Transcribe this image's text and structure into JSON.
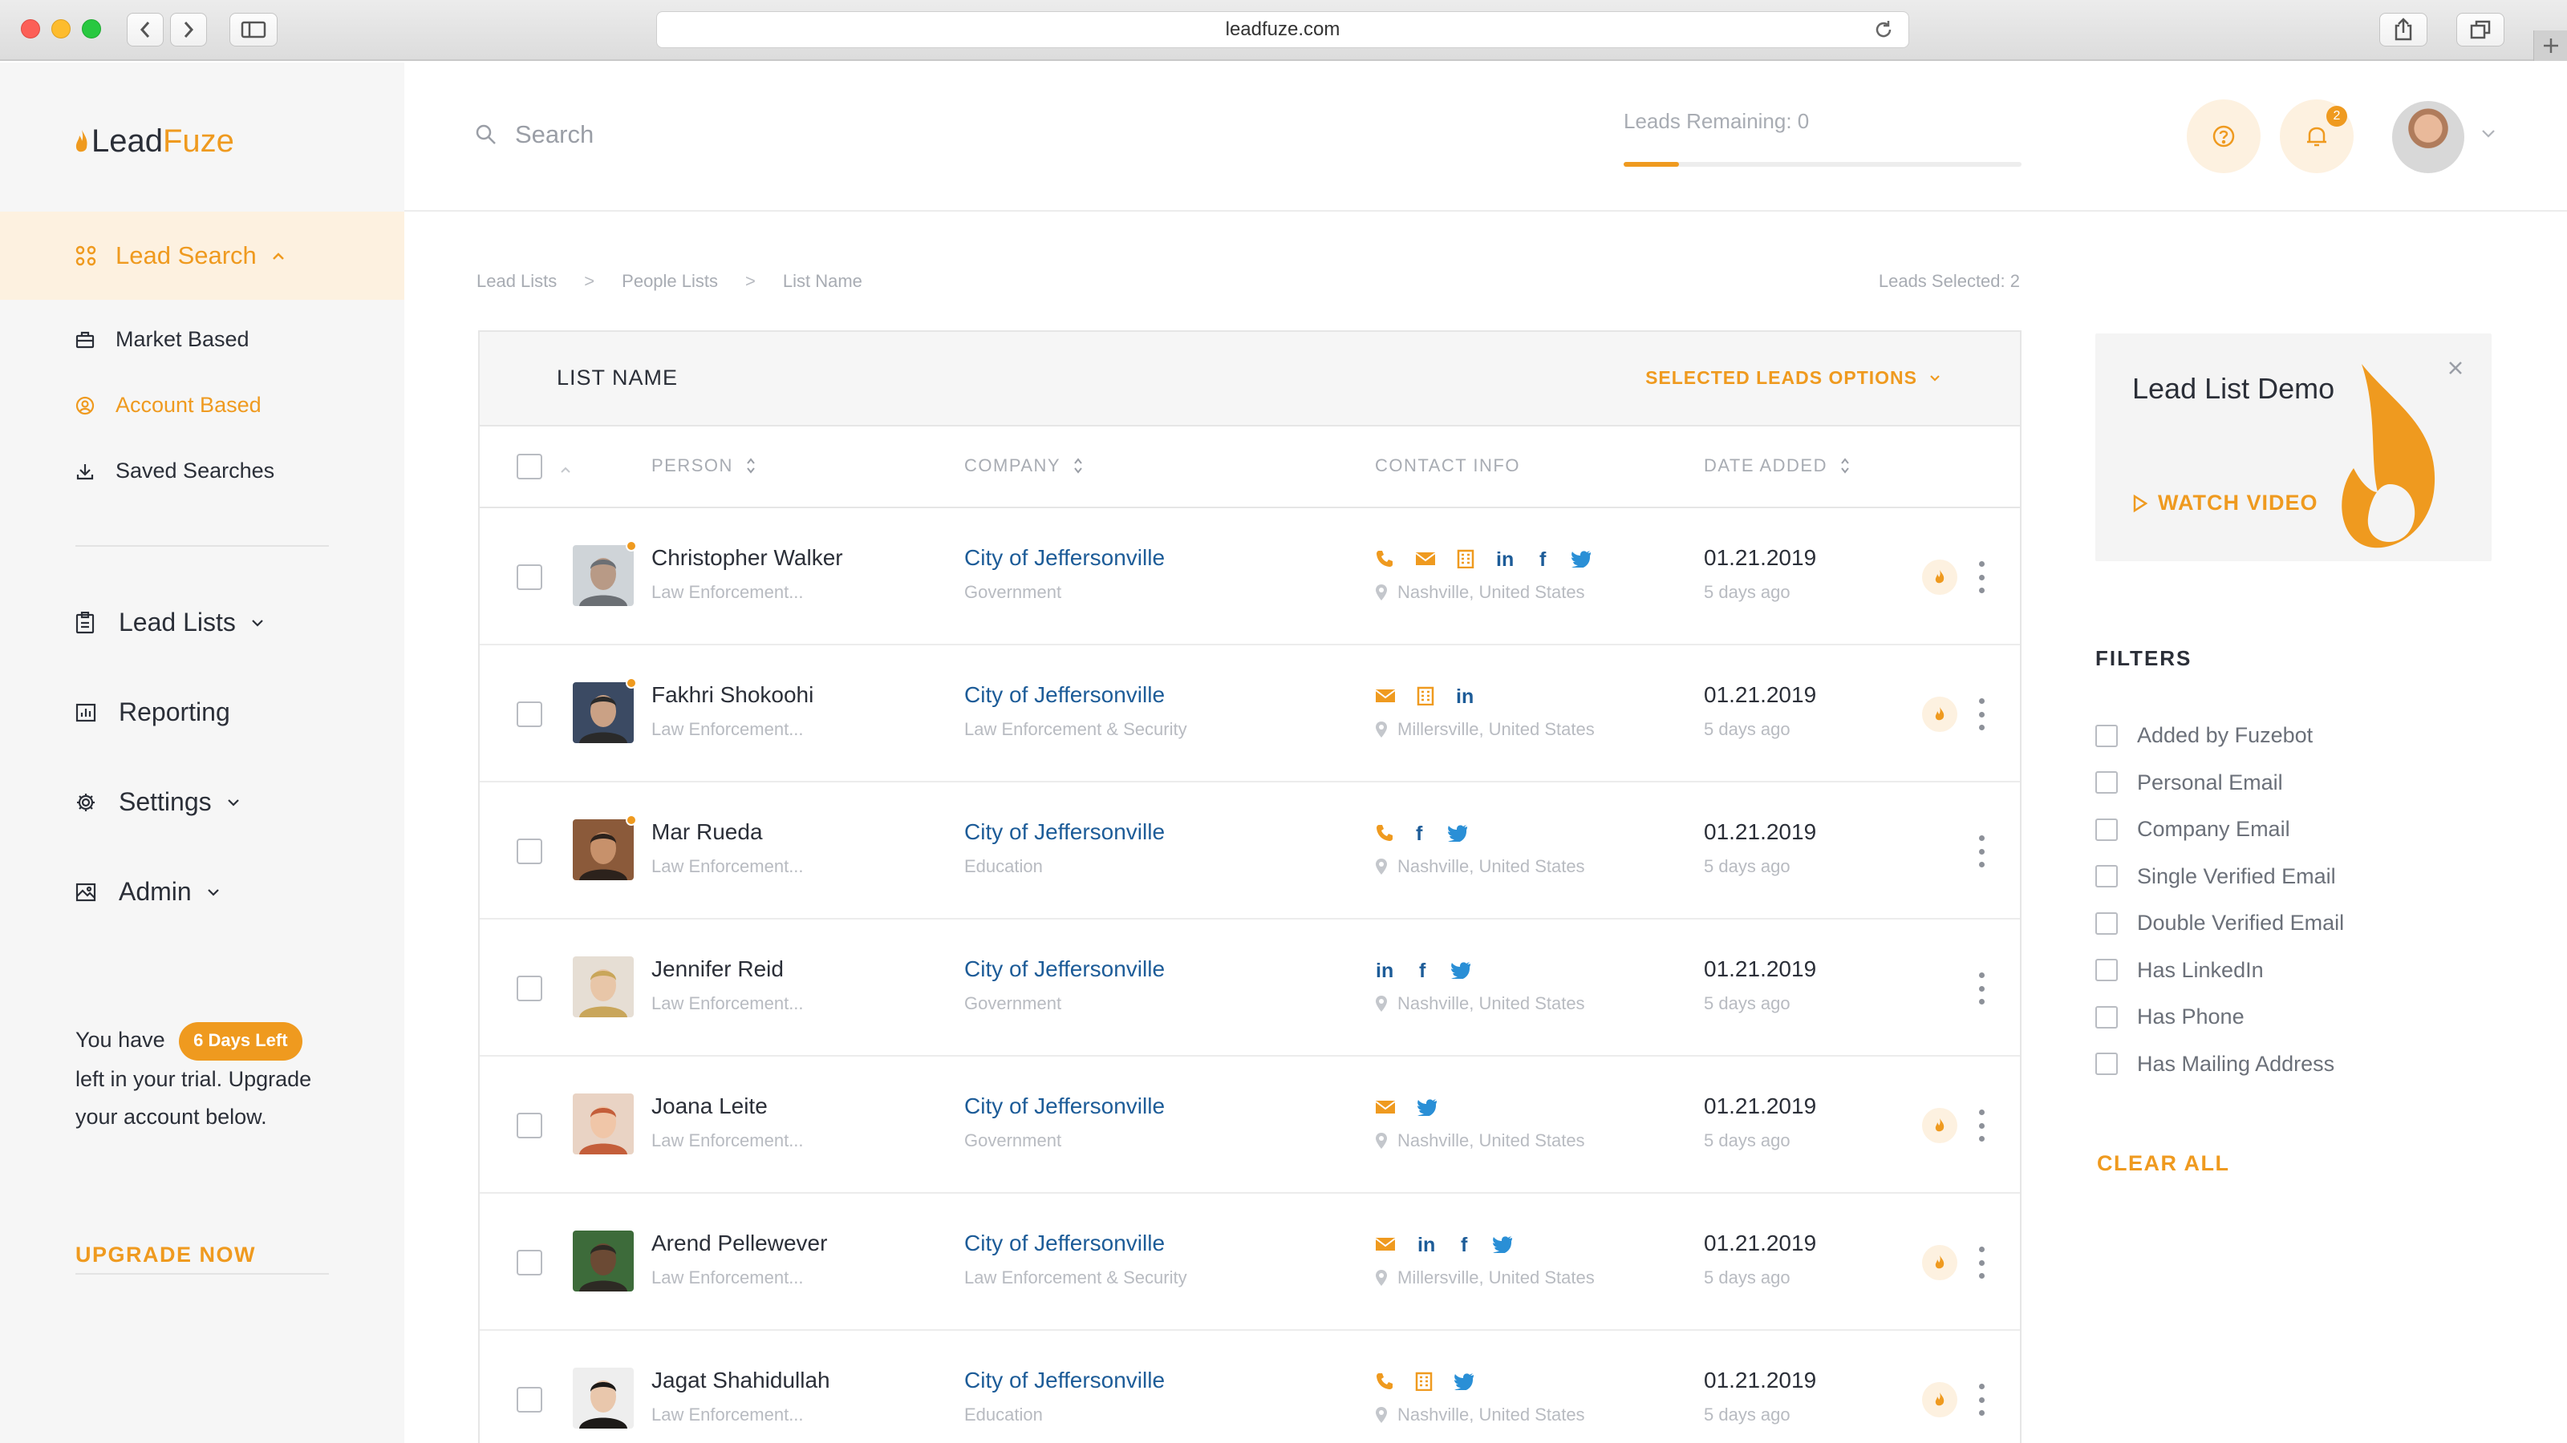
{
  "browser": {
    "url": "leadfuze.com"
  },
  "brand": {
    "name_part1": "Lead",
    "name_part2": "Fuze",
    "accent": "#ef9a1f",
    "link": "#1d5c98"
  },
  "sidebar": {
    "active_item": "Lead Search",
    "sub_items": [
      {
        "label": "Market Based",
        "icon": "briefcase-icon"
      },
      {
        "label": "Account Based",
        "icon": "user-circle-icon"
      },
      {
        "label": "Saved Searches",
        "icon": "download-icon"
      }
    ],
    "main_items": [
      {
        "label": "Lead Lists",
        "icon": "clipboard-icon"
      },
      {
        "label": "Reporting",
        "icon": "bar-chart-icon"
      },
      {
        "label": "Settings",
        "icon": "gear-icon"
      },
      {
        "label": "Admin",
        "icon": "image-icon"
      }
    ],
    "trial": {
      "prefix": "You have",
      "badge": "6 Days Left",
      "suffix": "left in your trial. Upgrade your account below."
    },
    "upgrade_label": "UPGRADE NOW"
  },
  "topbar": {
    "search_placeholder": "Search",
    "leads_remaining": "Leads Remaining: 0",
    "leads_progress": 0.14,
    "notification_count": "2"
  },
  "breadcrumb": [
    "Lead Lists",
    "People Lists",
    "List Name"
  ],
  "leads_selected": "Leads Selected: 2",
  "table": {
    "title": "LIST NAME",
    "options_label": "SELECTED LEADS OPTIONS",
    "columns": {
      "person": "PERSON",
      "company": "COMPANY",
      "contact": "CONTACT INFO",
      "date": "DATE ADDED"
    },
    "rows": [
      {
        "name": "Christopher Walker",
        "title": "Law Enforcement...",
        "company": "City of Jeffersonville",
        "industry": "Government",
        "location": "Nashville, United States",
        "date": "01.21.2019",
        "ago": "5 days ago"
      },
      {
        "name": "Fakhri Shokoohi",
        "title": "Law Enforcement...",
        "company": "City of Jeffersonville",
        "industry": "Law Enforcement & Security",
        "location": "Millersville, United States",
        "date": "01.21.2019",
        "ago": "5 days ago"
      },
      {
        "name": "Mar Rueda",
        "title": "Law Enforcement...",
        "company": "City of Jeffersonville",
        "industry": "Education",
        "location": "Nashville, United States",
        "date": "01.21.2019",
        "ago": "5 days ago"
      },
      {
        "name": "Jennifer Reid",
        "title": "Law Enforcement...",
        "company": "City of Jeffersonville",
        "industry": "Government",
        "location": "Nashville, United States",
        "date": "01.21.2019",
        "ago": "5 days ago"
      },
      {
        "name": "Joana Leite",
        "title": "Law Enforcement...",
        "company": "City of Jeffersonville",
        "industry": "Government",
        "location": "Nashville, United States",
        "date": "01.21.2019",
        "ago": "5 days ago"
      },
      {
        "name": "Arend Pellewever",
        "title": "Law Enforcement...",
        "company": "City of Jeffersonville",
        "industry": "Law Enforcement & Security",
        "location": "Millersville, United States",
        "date": "01.21.2019",
        "ago": "5 days ago"
      },
      {
        "name": "Jagat Shahidullah",
        "title": "Law Enforcement...",
        "company": "City of Jeffersonville",
        "industry": "Education",
        "location": "Nashville, United States",
        "date": "01.21.2019",
        "ago": "5 days ago"
      }
    ]
  },
  "demo": {
    "title": "Lead List Demo",
    "watch_label": "WATCH VIDEO"
  },
  "filters": {
    "title": "FILTERS",
    "items": [
      "Added by Fuzebot",
      "Personal Email",
      "Company Email",
      "Single Verified Email",
      "Double Verified Email",
      "Has LinkedIn",
      "Has Phone",
      "Has Mailing Address"
    ],
    "clear_label": "CLEAR ALL"
  }
}
